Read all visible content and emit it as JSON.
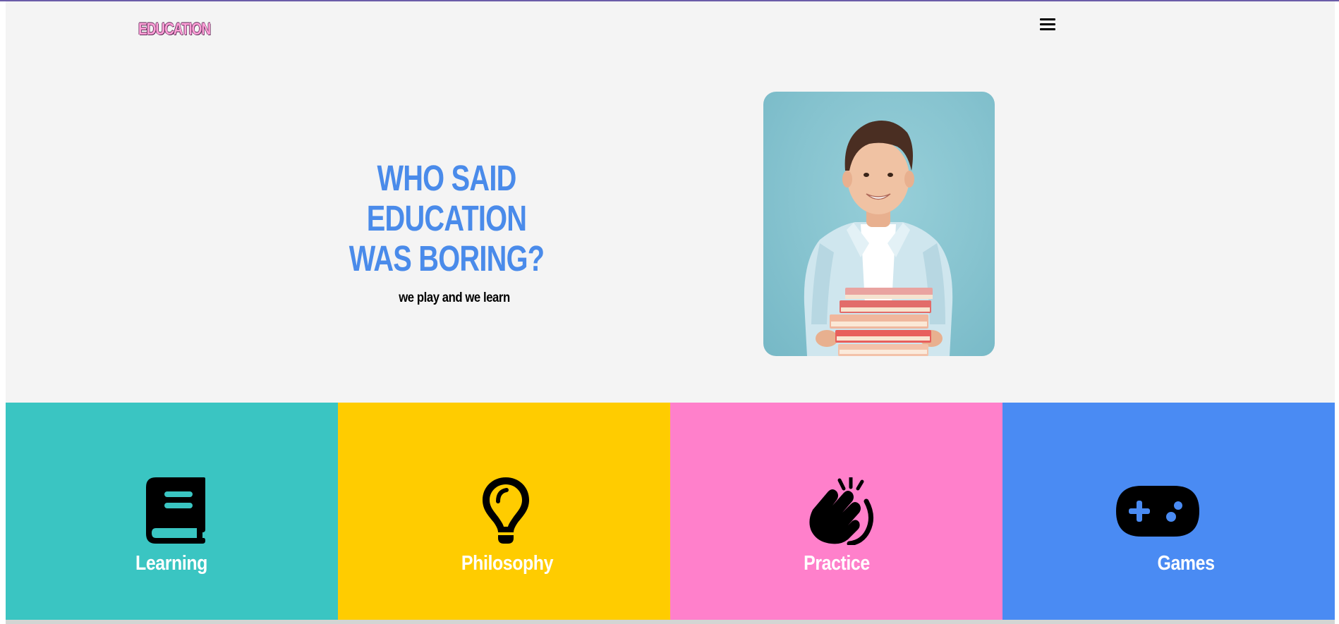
{
  "header": {
    "logo_text": "EDUCATION",
    "menu_icon": "hamburger-menu-icon"
  },
  "hero": {
    "title_lines": [
      "WHO SAID",
      "EDUCATION",
      "WAS BORING?"
    ],
    "subtitle": "we play and we learn",
    "image": "boy-holding-books-photo"
  },
  "features": [
    {
      "label": "Learning",
      "icon": "book-icon",
      "color": "#3ac5c2"
    },
    {
      "label": "Philosophy",
      "icon": "lightbulb-icon",
      "color": "#ffcc00"
    },
    {
      "label": "Practice",
      "icon": "waving-hand-icon",
      "color": "#ff80cb"
    },
    {
      "label": "Games",
      "icon": "gamepad-icon",
      "color": "#4a8bf3"
    }
  ],
  "colors": {
    "accent_blue": "#4a8bea",
    "logo_pink": "#ff9fd7",
    "page_background": "#f4f4f4"
  }
}
